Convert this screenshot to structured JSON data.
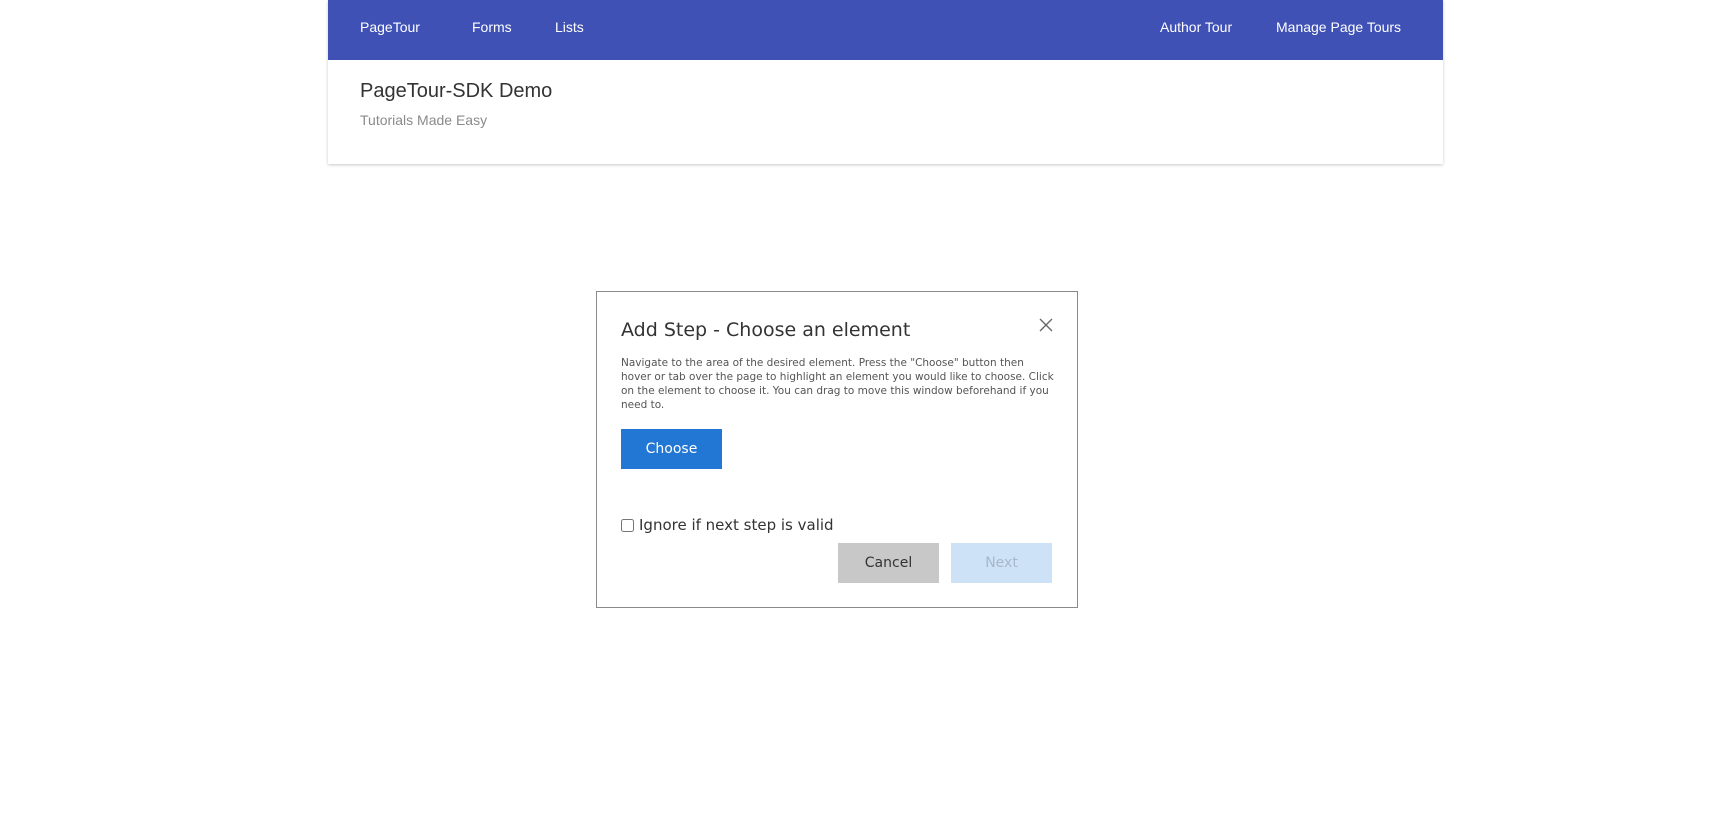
{
  "nav": {
    "brand": "PageTour",
    "links": [
      "Forms",
      "Lists"
    ],
    "right_links": [
      "Author Tour",
      "Manage Page Tours"
    ]
  },
  "header": {
    "title": "PageTour-SDK Demo",
    "subtitle": "Tutorials Made Easy"
  },
  "dialog": {
    "title": "Add Step - Choose an element",
    "description": "Navigate to the area of the desired element. Press the \"Choose\" button then hover or tab over the page to highlight an element you would like to choose. Click on the element to choose it. You can drag to move this window beforehand if you need to.",
    "choose_label": "Choose",
    "ignore_label": "Ignore if next step is valid",
    "ignore_checked": false,
    "cancel_label": "Cancel",
    "next_label": "Next",
    "next_disabled": true,
    "close_icon": "close-icon"
  },
  "colors": {
    "nav_bg": "#3f51b5",
    "primary_button": "#2277d4",
    "cancel_button": "#c8c8c8",
    "disabled_button": "#cde2f7"
  }
}
